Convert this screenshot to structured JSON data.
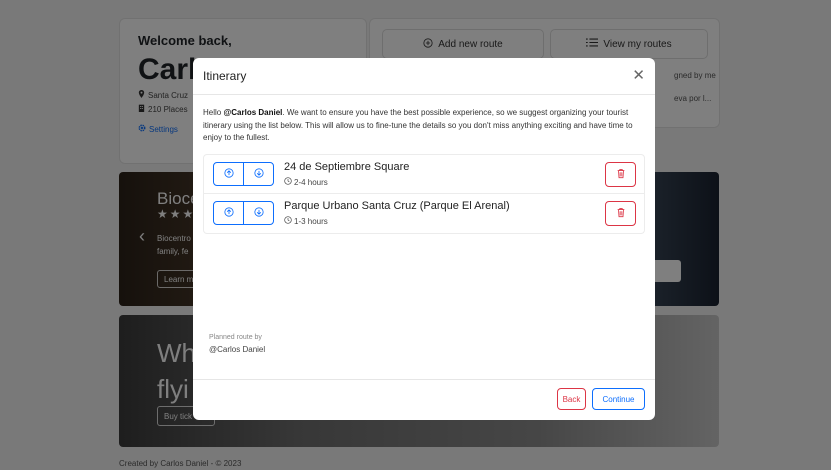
{
  "background": {
    "welcome": {
      "title": "Welcome back,",
      "user_partial": "Carlo",
      "location_partial": "Santa Cruz",
      "places_partial": "210 Places",
      "settings_label": "Settings"
    },
    "routes": {
      "add_label": "Add new route",
      "view_label": "View my routes",
      "assigned_partial": "gned by me",
      "lleva_partial": "eva por l..."
    },
    "carousel1": {
      "title_partial": "Bioce",
      "stars": "★★★",
      "desc_line1": "Biocentro",
      "desc_line2": "family, fe",
      "learn_partial": "Learn m"
    },
    "carousel2": {
      "title_line1": "Wh",
      "title_line2": "flyi",
      "buy_partial": "Buy tick"
    },
    "footer": "Created by Carlos Daniel - © 2023"
  },
  "modal": {
    "title": "Itinerary",
    "close_glyph": "✕",
    "intro_greeting": "Hello ",
    "intro_user": "@Carlos Daniel",
    "intro_text": ". We want to ensure you have the best possible experience, so we suggest organizing your tourist itinerary using the list below. This will allow us to fine-tune the details so you don't miss anything exciting and have time to enjoy to the fullest.",
    "items": [
      {
        "name": "24 de Septiembre Square",
        "duration": "2-4 hours"
      },
      {
        "name": "Parque Urbano Santa Cruz (Parque El Arenal)",
        "duration": "1-3 hours"
      }
    ],
    "planned_label": "Planned route by",
    "planned_user": "@Carlos Daniel",
    "back_label": "Back",
    "continue_label": "Continue"
  },
  "colors": {
    "primary": "#0d6efd",
    "danger": "#dc3545",
    "backdrop": "rgba(0,0,0,0.5)"
  }
}
